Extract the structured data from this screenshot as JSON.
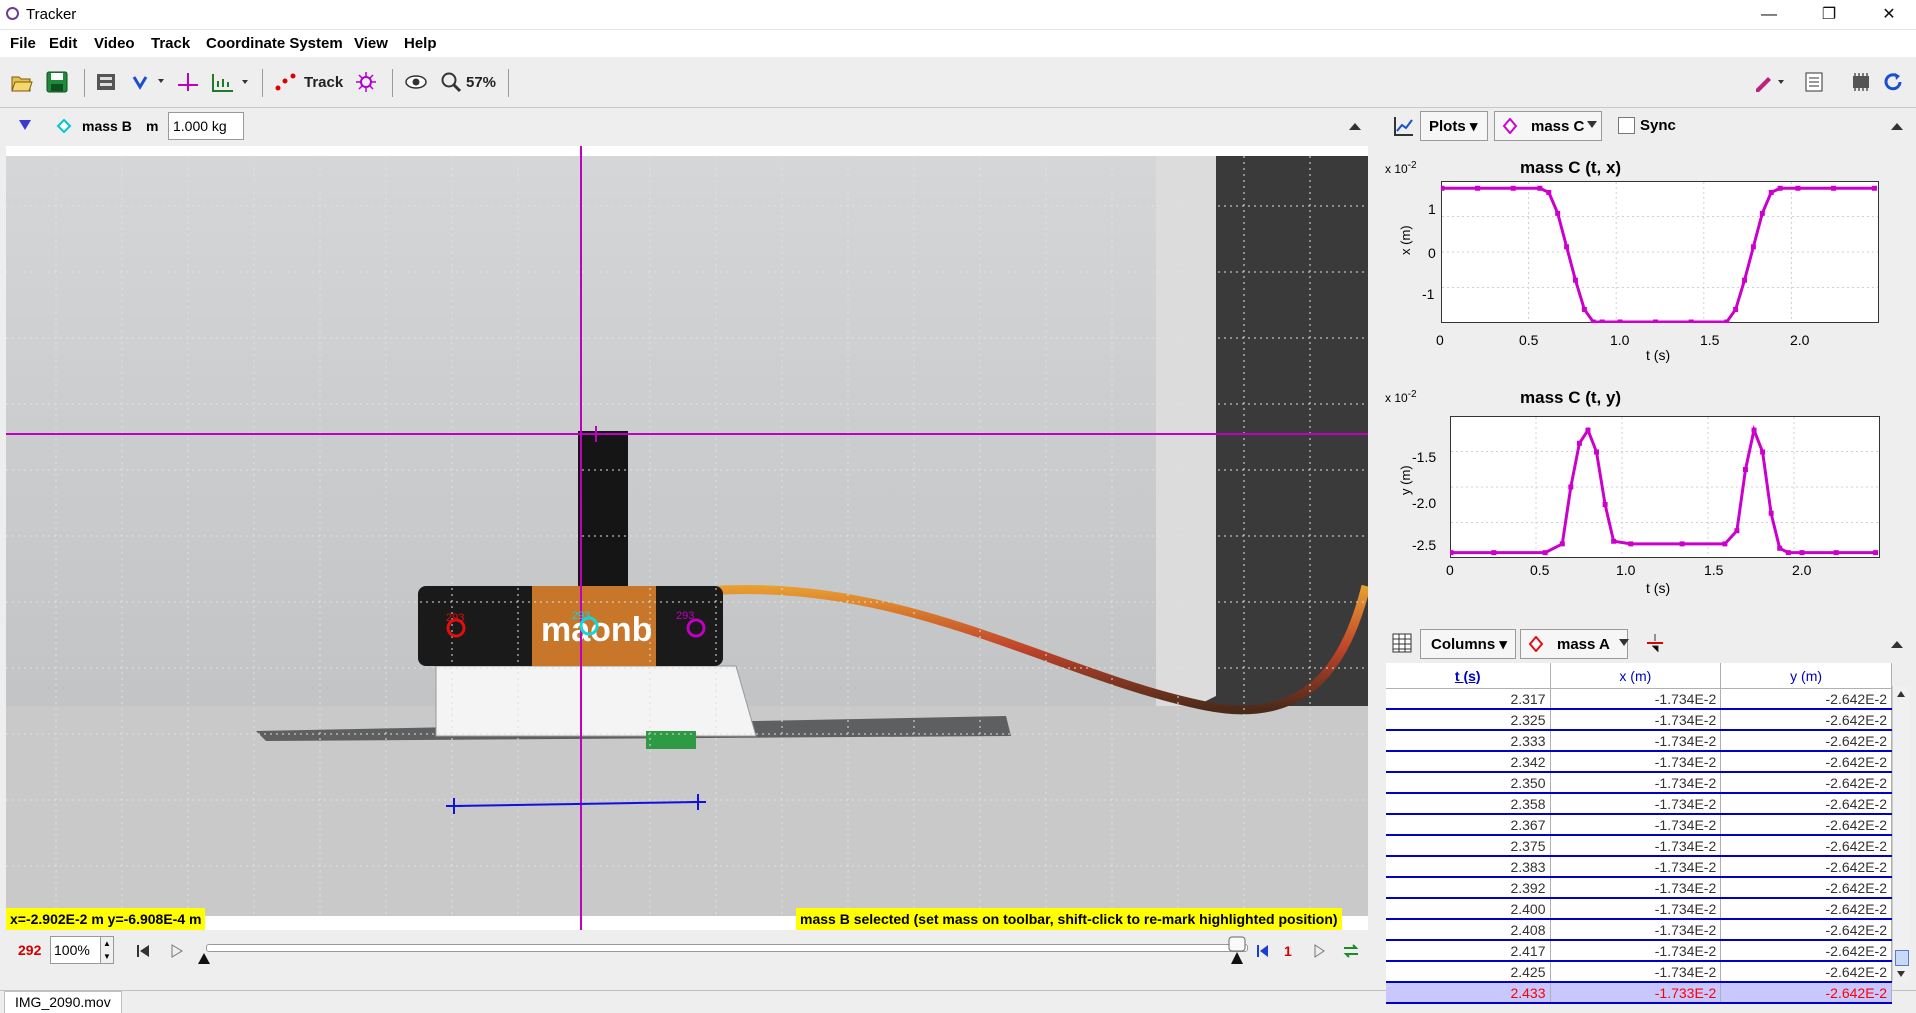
{
  "window": {
    "title": "Tracker",
    "minimize": "—",
    "restore": "❐",
    "close": "✕"
  },
  "menu": [
    "File",
    "Edit",
    "Video",
    "Track",
    "Coordinate System",
    "View",
    "Help"
  ],
  "toolbar": {
    "track_label": "Track",
    "zoom_label": "57%"
  },
  "trackbar": {
    "track_name": "mass B",
    "mass_symbol": "m",
    "mass_value": "1.000 kg"
  },
  "video": {
    "marker_red_label": "293",
    "marker_cyan_label": "293",
    "marker_magenta_label": "293",
    "battery_text": "maonb",
    "status_coords": "x=-2.902E-2 m  y=-6.908E-4 m",
    "status_message": "mass B selected (set mass on toolbar, shift-click to re-mark highlighted position)"
  },
  "player": {
    "frame": "292",
    "rate": "100%",
    "step": "1"
  },
  "bottom_tab": "IMG_2090.mov",
  "plots_panel": {
    "plots_label": "Plots",
    "track_label": "mass C",
    "sync_label": "Sync",
    "plot1": {
      "title": "mass C (t, x)",
      "scale": "x 10",
      "scale_exp": "-2",
      "ylabel": "x (m)",
      "xlabel": "t (s)",
      "yticks": [
        "1",
        "0",
        "-1"
      ],
      "xticks": [
        "0",
        "0.5",
        "1.0",
        "1.5",
        "2.0"
      ]
    },
    "plot2": {
      "title": "mass C (t, y)",
      "scale": "x 10",
      "scale_exp": "-2",
      "ylabel": "y (m)",
      "xlabel": "t (s)",
      "yticks": [
        "-1.5",
        "-2.0",
        "-2.5"
      ],
      "xticks": [
        "0",
        "0.5",
        "1.0",
        "1.5",
        "2.0"
      ]
    }
  },
  "chart_data": [
    {
      "type": "line",
      "title": "mass C (t, x)",
      "xlabel": "t (s)",
      "ylabel": "x (m)",
      "xlim": [
        0,
        2.45
      ],
      "ylim": [
        -1.6,
        1.75
      ],
      "color": "#cc00cc",
      "x": [
        0,
        0.2,
        0.4,
        0.55,
        0.6,
        0.65,
        0.7,
        0.75,
        0.8,
        0.85,
        0.9,
        1.0,
        1.2,
        1.4,
        1.6,
        1.65,
        1.7,
        1.75,
        1.8,
        1.85,
        1.9,
        2.0,
        2.2,
        2.43
      ],
      "y": [
        1.6,
        1.6,
        1.6,
        1.6,
        1.5,
        1.0,
        0.2,
        -0.6,
        -1.3,
        -1.6,
        -1.6,
        -1.6,
        -1.6,
        -1.6,
        -1.6,
        -1.3,
        -0.6,
        0.2,
        1.0,
        1.5,
        1.6,
        1.6,
        1.6,
        1.6
      ]
    },
    {
      "type": "line",
      "title": "mass C (t, y)",
      "xlabel": "t (s)",
      "ylabel": "y (m)",
      "xlim": [
        -0.05,
        2.45
      ],
      "ylim": [
        -2.6,
        -1.0
      ],
      "color": "#cc00cc",
      "x": [
        -0.05,
        0.2,
        0.5,
        0.6,
        0.65,
        0.7,
        0.75,
        0.8,
        0.85,
        0.9,
        1.0,
        1.3,
        1.55,
        1.62,
        1.67,
        1.72,
        1.77,
        1.82,
        1.87,
        1.92,
        2.0,
        2.2,
        2.43
      ],
      "y": [
        -2.55,
        -2.55,
        -2.55,
        -2.45,
        -1.8,
        -1.3,
        -1.15,
        -1.4,
        -2.0,
        -2.42,
        -2.45,
        -2.45,
        -2.45,
        -2.3,
        -1.6,
        -1.15,
        -1.4,
        -2.1,
        -2.5,
        -2.55,
        -2.55,
        -2.55,
        -2.55
      ]
    }
  ],
  "table_panel": {
    "columns_label": "Columns",
    "track_label": "mass A",
    "headers": [
      "t (s)",
      "x (m)",
      "y (m)"
    ],
    "rows": [
      [
        "2.317",
        "-1.734E-2",
        "-2.642E-2"
      ],
      [
        "2.325",
        "-1.734E-2",
        "-2.642E-2"
      ],
      [
        "2.333",
        "-1.734E-2",
        "-2.642E-2"
      ],
      [
        "2.342",
        "-1.734E-2",
        "-2.642E-2"
      ],
      [
        "2.350",
        "-1.734E-2",
        "-2.642E-2"
      ],
      [
        "2.358",
        "-1.734E-2",
        "-2.642E-2"
      ],
      [
        "2.367",
        "-1.734E-2",
        "-2.642E-2"
      ],
      [
        "2.375",
        "-1.734E-2",
        "-2.642E-2"
      ],
      [
        "2.383",
        "-1.734E-2",
        "-2.642E-2"
      ],
      [
        "2.392",
        "-1.734E-2",
        "-2.642E-2"
      ],
      [
        "2.400",
        "-1.734E-2",
        "-2.642E-2"
      ],
      [
        "2.408",
        "-1.734E-2",
        "-2.642E-2"
      ],
      [
        "2.417",
        "-1.734E-2",
        "-2.642E-2"
      ],
      [
        "2.425",
        "-1.734E-2",
        "-2.642E-2"
      ],
      [
        "2.433",
        "-1.733E-2",
        "-2.642E-2"
      ]
    ]
  }
}
